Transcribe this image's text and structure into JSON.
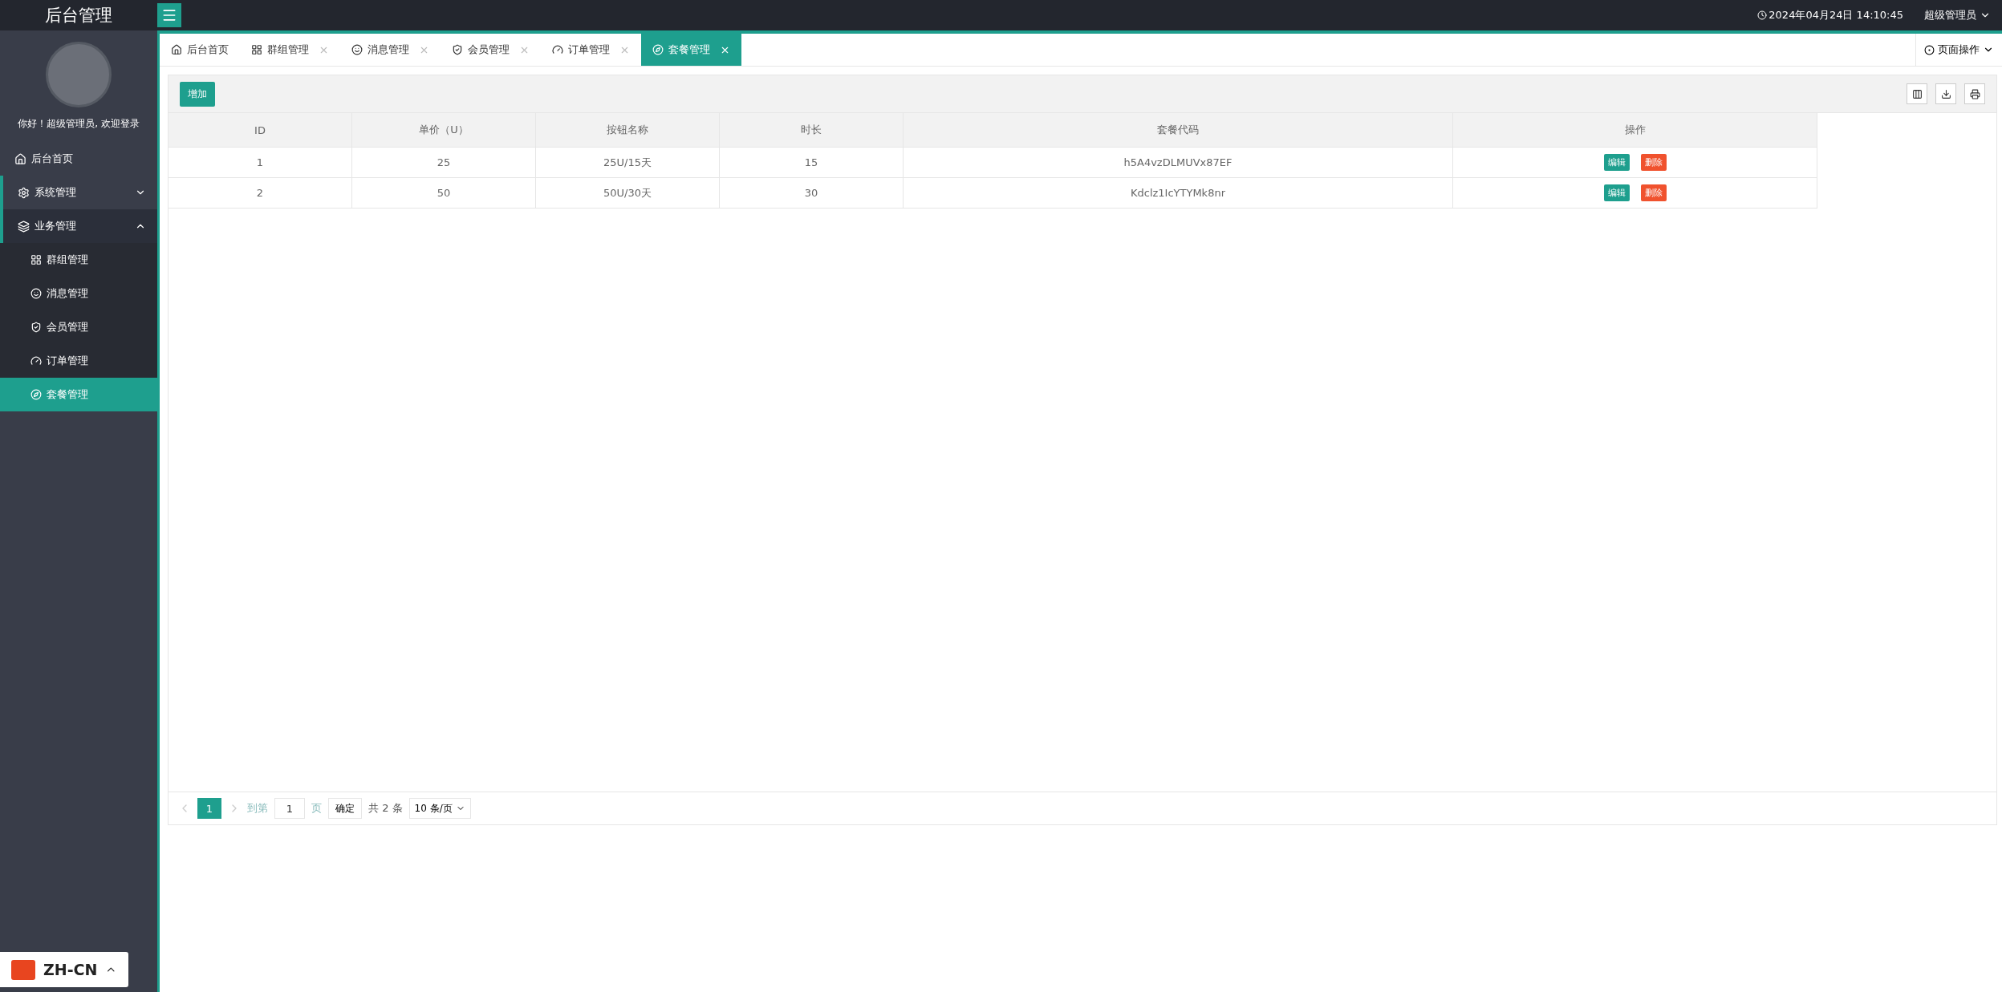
{
  "header": {
    "title": "后台管理",
    "datetime": "2024年04月24日 14:10:45",
    "user": "超级管理员"
  },
  "sidebar": {
    "greeting": "你好！超级管理员, 欢迎登录",
    "items": [
      {
        "label": "后台首页",
        "kind": "link",
        "selected": false
      },
      {
        "label": "系统管理",
        "kind": "group",
        "expanded": false
      },
      {
        "label": "业务管理",
        "kind": "group",
        "expanded": true,
        "children": [
          {
            "label": "群组管理",
            "selected": false
          },
          {
            "label": "消息管理",
            "selected": false
          },
          {
            "label": "会员管理",
            "selected": false
          },
          {
            "label": "订单管理",
            "selected": false
          },
          {
            "label": "套餐管理",
            "selected": true
          }
        ]
      }
    ]
  },
  "tabs": [
    {
      "label": "后台首页",
      "closable": false,
      "selected": false
    },
    {
      "label": "群组管理",
      "closable": true,
      "selected": false
    },
    {
      "label": "消息管理",
      "closable": true,
      "selected": false
    },
    {
      "label": "会员管理",
      "closable": true,
      "selected": false
    },
    {
      "label": "订单管理",
      "closable": true,
      "selected": false
    },
    {
      "label": "套餐管理",
      "closable": true,
      "selected": true
    }
  ],
  "page_actions": "页面操作",
  "toolbar": {
    "add_button": "增加"
  },
  "table": {
    "columns": [
      "ID",
      "单价（U）",
      "按钮名称",
      "时长",
      "套餐代码",
      "操作"
    ],
    "rows": [
      {
        "cells": [
          "1",
          "25",
          "25U/15天",
          "15",
          "h5A4vzDLMUVx87EF"
        ],
        "actions": [
          {
            "label": "编辑",
            "kind": "edit"
          },
          {
            "label": "删除",
            "kind": "delete"
          }
        ]
      },
      {
        "cells": [
          "2",
          "50",
          "50U/30天",
          "30",
          "Kdclz1IcYTYMk8nr"
        ],
        "actions": [
          {
            "label": "编辑",
            "kind": "edit"
          },
          {
            "label": "删除",
            "kind": "delete"
          }
        ]
      }
    ]
  },
  "pagination": {
    "pages": [
      {
        "label": "1",
        "selected": true
      }
    ],
    "goto_label": "到第",
    "goto_value": "1",
    "page_unit": "页",
    "confirm": "确定",
    "total": "共 2 条",
    "page_size": "10 条/页"
  },
  "language": "ZH-CN"
}
